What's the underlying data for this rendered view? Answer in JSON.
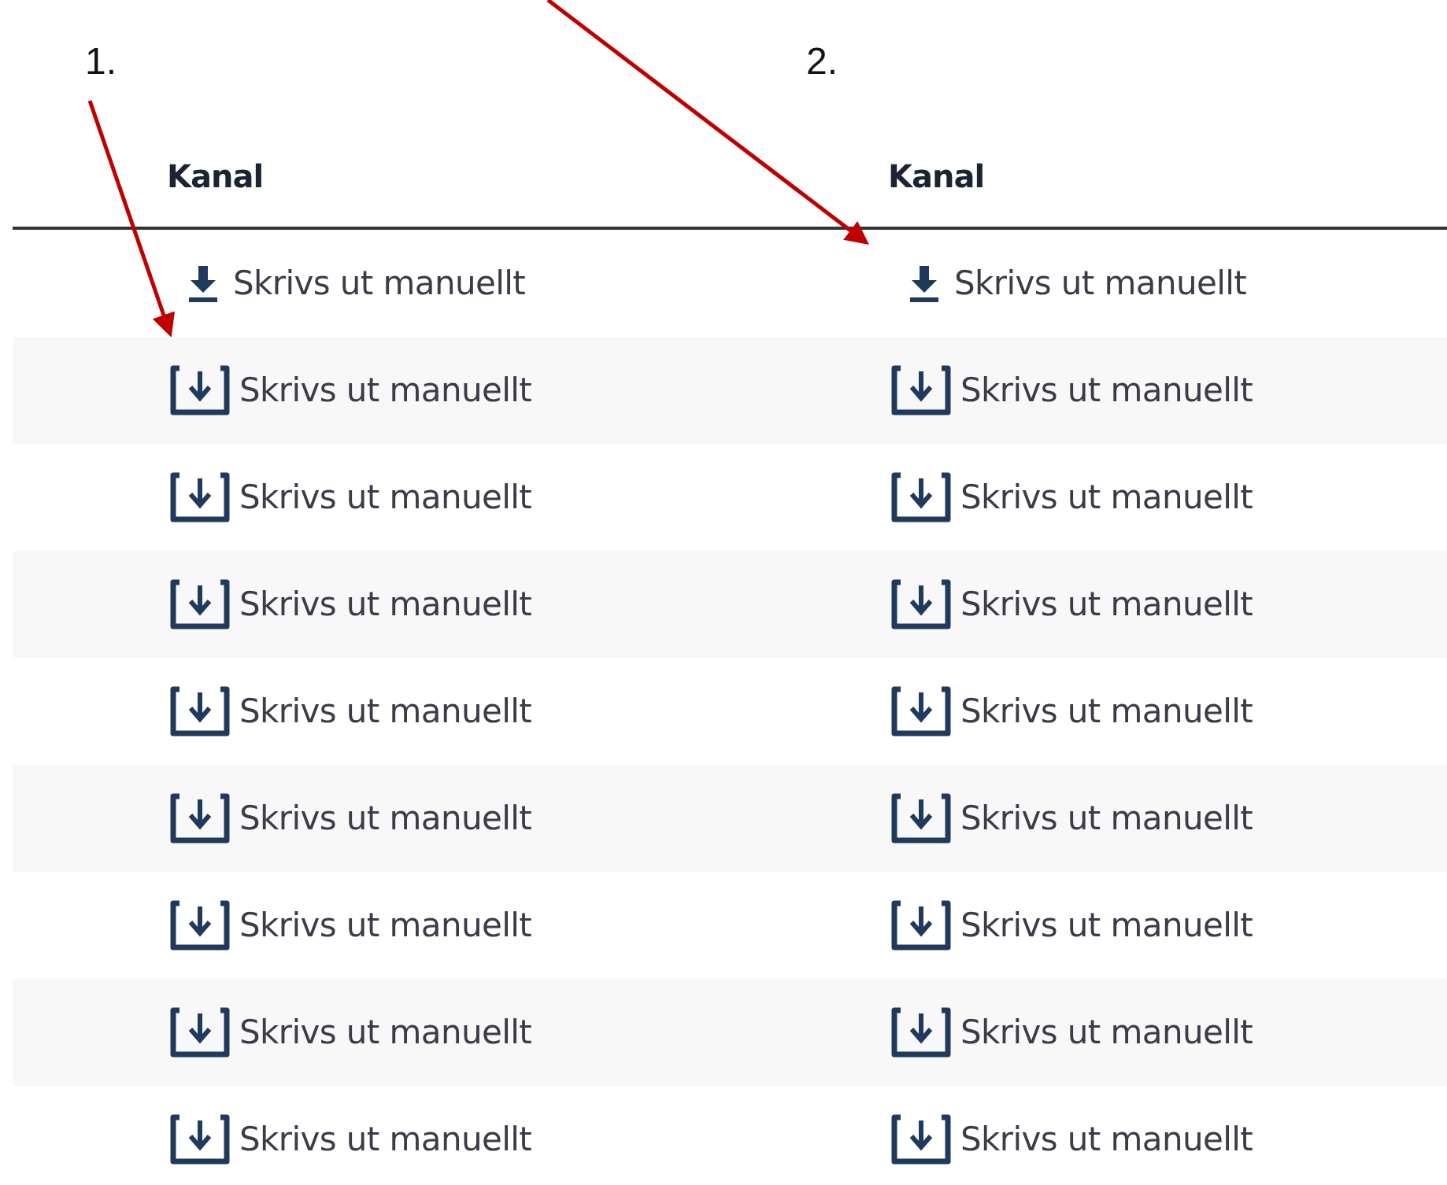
{
  "annotations": [
    {
      "label": "1."
    },
    {
      "label": "2."
    }
  ],
  "table": {
    "columns": [
      "Kanal",
      "Kanal"
    ],
    "rows": [
      {
        "cells": [
          {
            "kind": "download",
            "text": "Skrivs ut manuellt"
          },
          {
            "kind": "download",
            "text": "Skrivs ut manuellt"
          }
        ]
      },
      {
        "cells": [
          {
            "kind": "tray",
            "text": "Skrivs ut manuellt"
          },
          {
            "kind": "tray",
            "text": "Skrivs ut manuellt"
          }
        ]
      },
      {
        "cells": [
          {
            "kind": "tray",
            "text": "Skrivs ut manuellt"
          },
          {
            "kind": "tray",
            "text": "Skrivs ut manuellt"
          }
        ]
      },
      {
        "cells": [
          {
            "kind": "tray",
            "text": "Skrivs ut manuellt"
          },
          {
            "kind": "tray",
            "text": "Skrivs ut manuellt"
          }
        ]
      },
      {
        "cells": [
          {
            "kind": "tray",
            "text": "Skrivs ut manuellt"
          },
          {
            "kind": "tray",
            "text": "Skrivs ut manuellt"
          }
        ]
      },
      {
        "cells": [
          {
            "kind": "tray",
            "text": "Skrivs ut manuellt"
          },
          {
            "kind": "tray",
            "text": "Skrivs ut manuellt"
          }
        ]
      },
      {
        "cells": [
          {
            "kind": "tray",
            "text": "Skrivs ut manuellt"
          },
          {
            "kind": "tray",
            "text": "Skrivs ut manuellt"
          }
        ]
      },
      {
        "cells": [
          {
            "kind": "tray",
            "text": "Skrivs ut manuellt"
          },
          {
            "kind": "tray",
            "text": "Skrivs ut manuellt"
          }
        ]
      },
      {
        "cells": [
          {
            "kind": "tray",
            "text": "Skrivs ut manuellt"
          },
          {
            "kind": "tray",
            "text": "Skrivs ut manuellt"
          }
        ]
      }
    ]
  }
}
